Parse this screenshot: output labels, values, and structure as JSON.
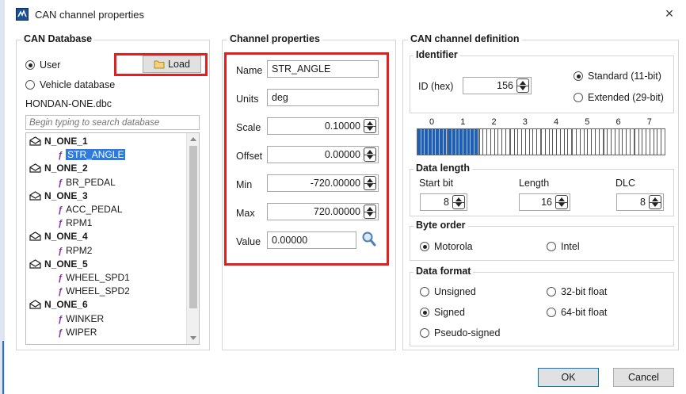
{
  "window": {
    "title": "CAN channel properties",
    "close": "×"
  },
  "db": {
    "title": "CAN Database",
    "user": "User",
    "load": "Load",
    "vehicle": "Vehicle database",
    "file": "HONDAN-ONE.dbc",
    "search_placeholder": "Begin typing to search database",
    "tree": [
      {
        "label": "N_ONE_1",
        "kind": "node"
      },
      {
        "label": "STR_ANGLE",
        "kind": "signal",
        "selected": true
      },
      {
        "label": "N_ONE_2",
        "kind": "node"
      },
      {
        "label": "BR_PEDAL",
        "kind": "signal"
      },
      {
        "label": "N_ONE_3",
        "kind": "node"
      },
      {
        "label": "ACC_PEDAL",
        "kind": "signal"
      },
      {
        "label": "RPM1",
        "kind": "signal"
      },
      {
        "label": "N_ONE_4",
        "kind": "node"
      },
      {
        "label": "RPM2",
        "kind": "signal"
      },
      {
        "label": "N_ONE_5",
        "kind": "node"
      },
      {
        "label": "WHEEL_SPD1",
        "kind": "signal"
      },
      {
        "label": "WHEEL_SPD2",
        "kind": "signal"
      },
      {
        "label": "N_ONE_6",
        "kind": "node"
      },
      {
        "label": "WINKER",
        "kind": "signal"
      },
      {
        "label": "WIPER",
        "kind": "signal"
      }
    ]
  },
  "props": {
    "title": "Channel properties",
    "name_label": "Name",
    "name_value": "STR_ANGLE",
    "units_label": "Units",
    "units_value": "deg",
    "scale_label": "Scale",
    "scale_value": "0.10000",
    "offset_label": "Offset",
    "offset_value": "0.00000",
    "min_label": "Min",
    "min_value": "-720.00000",
    "max_label": "Max",
    "max_value": "720.00000",
    "value_label": "Value",
    "value_value": "0.00000"
  },
  "def": {
    "title": "CAN channel definition",
    "identifier_title": "Identifier",
    "id_label": "ID (hex)",
    "id_value": "156",
    "standard": "Standard (11-bit)",
    "extended": "Extended (29-bit)",
    "bytes": [
      "0",
      "1",
      "2",
      "3",
      "4",
      "5",
      "6",
      "7"
    ],
    "active_bytes": [
      0,
      1
    ],
    "data_length_title": "Data length",
    "start_bit_label": "Start bit",
    "start_bit_value": "8",
    "length_label": "Length",
    "length_value": "16",
    "dlc_label": "DLC",
    "dlc_value": "8",
    "byte_order_title": "Byte order",
    "motorola": "Motorola",
    "intel": "Intel",
    "data_format_title": "Data format",
    "unsigned": "Unsigned",
    "float32": "32-bit float",
    "signed": "Signed",
    "float64": "64-bit float",
    "pseudo": "Pseudo-signed"
  },
  "buttons": {
    "ok": "OK",
    "cancel": "Cancel"
  },
  "colors": {
    "highlight_red": "#e02020",
    "selection_blue": "#2e7be0",
    "byte_active": "#1e5fb3"
  }
}
